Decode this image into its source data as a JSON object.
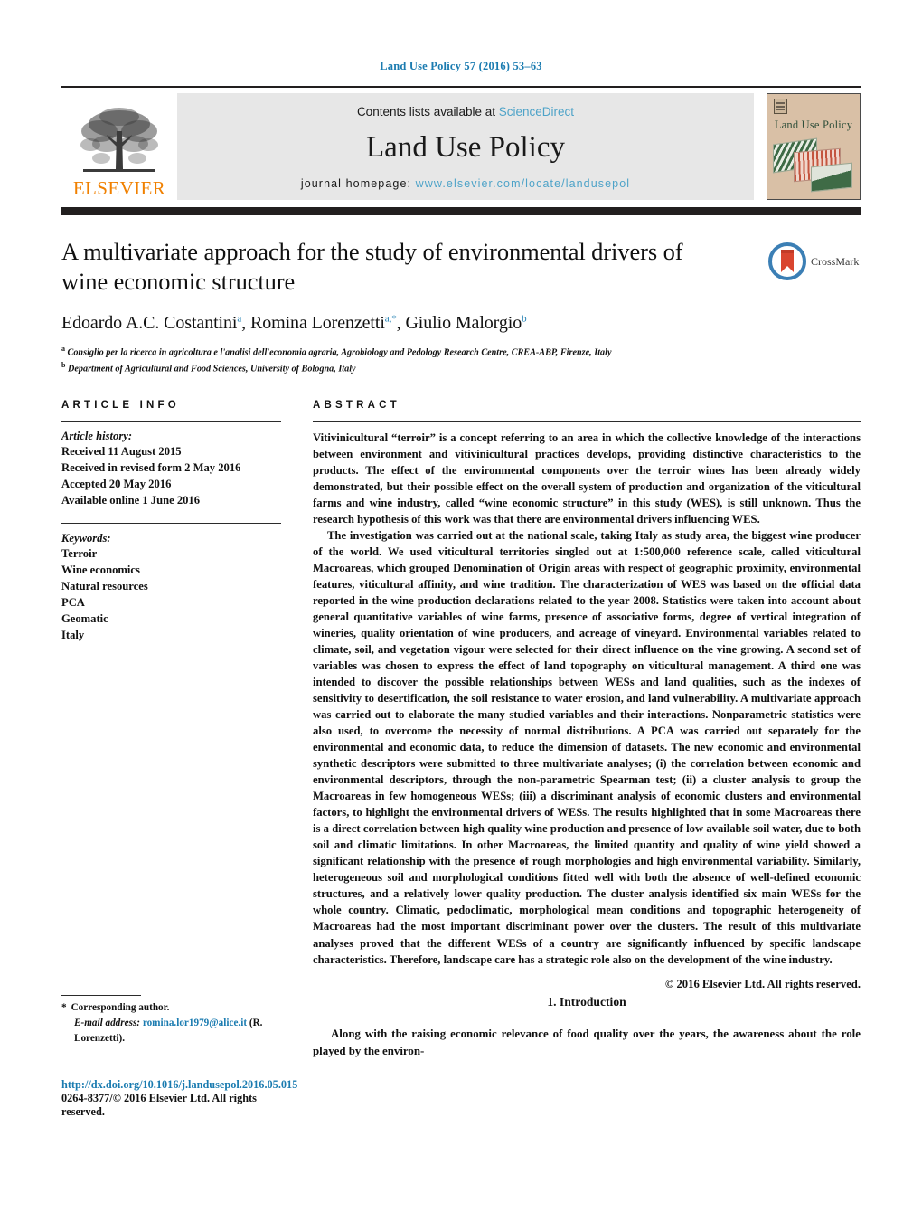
{
  "running_head": "Land Use Policy 57 (2016) 53–63",
  "masthead": {
    "publisher_name": "ELSEVIER",
    "contents_prefix": "Contents lists available at ",
    "contents_link": "ScienceDirect",
    "journal_name": "Land Use Policy",
    "homepage_prefix": "journal homepage: ",
    "homepage_url": "www.elsevier.com/locate/landusepol",
    "cover_title": "Land Use Policy"
  },
  "article": {
    "title": "A multivariate approach for the study of environmental drivers of wine economic structure",
    "authors_plain": "Edoardo A.C. Costantini a, Romina Lorenzetti a,*, Giulio Malorgio b",
    "authors": [
      {
        "name": "Edoardo A.C. Costantini",
        "marker": "a"
      },
      {
        "name": "Romina Lorenzetti",
        "marker": "a,*"
      },
      {
        "name": "Giulio Malorgio",
        "marker": "b"
      }
    ],
    "affiliations": [
      {
        "marker": "a",
        "text": "Consiglio per la ricerca in agricoltura e l'analisi dell'economia agraria, Agrobiology and Pedology Research Centre, CREA-ABP, Firenze, Italy"
      },
      {
        "marker": "b",
        "text": "Department of Agricultural and Food Sciences, University of Bologna, Italy"
      }
    ],
    "crossmark_label": "CrossMark"
  },
  "article_info": {
    "heading": "ARTICLE INFO",
    "history_label": "Article history:",
    "history": [
      "Received 11 August 2015",
      "Received in revised form 2 May 2016",
      "Accepted 20 May 2016",
      "Available online 1 June 2016"
    ],
    "keywords_label": "Keywords:",
    "keywords": [
      "Terroir",
      "Wine economics",
      "Natural resources",
      "PCA",
      "Geomatic",
      "Italy"
    ]
  },
  "abstract": {
    "heading": "ABSTRACT",
    "paragraphs": [
      "Vitivinicultural “terroir” is a concept referring to an area in which the collective knowledge of the interactions between environment and vitivinicultural practices develops, providing distinctive characteristics to the products. The effect of the environmental components over the terroir wines has been already widely demonstrated, but their possible effect on the overall system of production and organization of the viticultural farms and wine industry, called “wine economic structure” in this study (WES), is still unknown. Thus the research hypothesis of this work was that there are environmental drivers influencing WES.",
      "The investigation was carried out at the national scale, taking Italy as study area, the biggest wine producer of the world. We used viticultural territories singled out at 1:500,000 reference scale, called viticultural Macroareas, which grouped Denomination of Origin areas with respect of geographic proximity, environmental features, viticultural affinity, and wine tradition. The characterization of WES was based on the official data reported in the wine production declarations related to the year 2008. Statistics were taken into account about general quantitative variables of wine farms, presence of associative forms, degree of vertical integration of wineries, quality orientation of wine producers, and acreage of vineyard. Environmental variables related to climate, soil, and vegetation vigour were selected for their direct influence on the vine growing. A second set of variables was chosen to express the effect of land topography on viticultural management. A third one was intended to discover the possible relationships between WESs and land qualities, such as the indexes of sensitivity to desertification, the soil resistance to water erosion, and land vulnerability. A multivariate approach was carried out to elaborate the many studied variables and their interactions. Nonparametric statistics were also used, to overcome the necessity of normal distributions. A PCA was carried out separately for the environmental and economic data, to reduce the dimension of datasets. The new economic and environmental synthetic descriptors were submitted to three multivariate analyses; (i) the correlation between economic and environmental descriptors, through the non-parametric Spearman test; (ii) a cluster analysis to group the Macroareas in few homogeneous WESs; (iii) a discriminant analysis of economic clusters and environmental factors, to highlight the environmental drivers of WESs. The results highlighted that in some Macroareas there is a direct correlation between high quality wine production and presence of low available soil water, due to both soil and climatic limitations. In other Macroareas, the limited quantity and quality of wine yield showed a significant relationship with the presence of rough morphologies and high environmental variability. Similarly, heterogeneous soil and morphological conditions fitted well with both the absence of well-defined economic structures, and a relatively lower quality production. The cluster analysis identified six main WESs for the whole country. Climatic, pedoclimatic, morphological mean conditions and topographic heterogeneity of Macroareas had the most important discriminant power over the clusters. The result of this multivariate analyses proved that the different WESs of a country are significantly influenced by specific landscape characteristics. Therefore, landscape care has a strategic role also on the development of the wine industry."
    ],
    "copyright": "© 2016 Elsevier Ltd. All rights reserved."
  },
  "introduction": {
    "heading": "1.  Introduction",
    "paragraph": "Along with the raising economic relevance of food quality over the years, the awareness about the role played by the environ-"
  },
  "footer": {
    "corresponding_marker": "*",
    "corresponding_label": "Corresponding author.",
    "email_label": "E-mail address:",
    "email": "romina.lor1979@alice.it",
    "email_owner": "(R. Lorenzetti).",
    "doi": "http://dx.doi.org/10.1016/j.landusepol.2016.05.015",
    "issn_line": "0264-8377/© 2016 Elsevier Ltd. All rights reserved."
  },
  "colors": {
    "link_blue": "#1a7bb0",
    "sciencedirect_blue": "#4ea3c8",
    "elsevier_orange": "#f08000",
    "dark_bar": "#221f1f",
    "band_gray": "#e7e7e7"
  }
}
